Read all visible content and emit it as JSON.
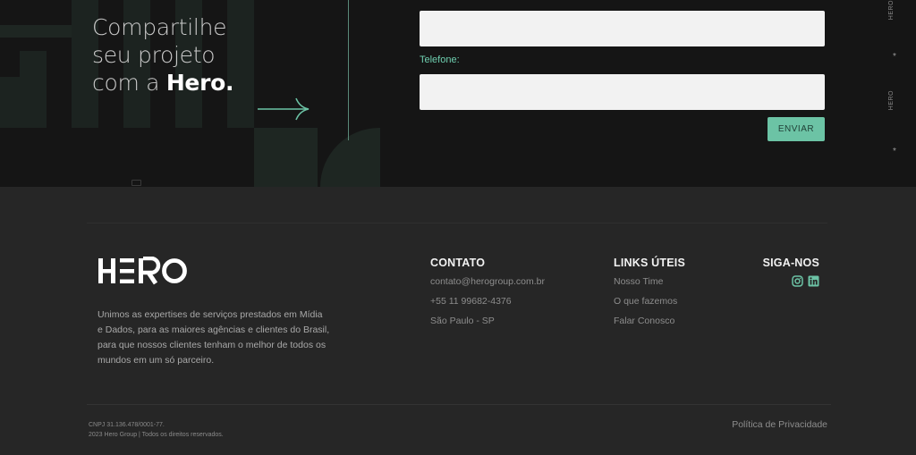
{
  "hero": {
    "heading_line1": "Compartilhe",
    "heading_line2": "seu projeto",
    "heading_line3_prefix": "com a ",
    "heading_brand": "Hero."
  },
  "form": {
    "top_field_value": "",
    "phone_label": "Telefone:",
    "phone_value": "",
    "send_label": "ENVIAR"
  },
  "side_rail": {
    "text_1": "HERO",
    "star_1": "*",
    "text_2": "HERO",
    "star_2": "*"
  },
  "footer": {
    "about": "Unimos as expertises de serviços prestados em Mídia e Dados, para as maiores agências e clientes do Brasil, para que nossos clientes tenham o melhor de todos os mundos em um só parceiro.",
    "contato": {
      "title": "CONTATO",
      "items": [
        "contato@herogroup.com.br",
        "+55 11 99682-4376",
        "São Paulo - SP"
      ]
    },
    "links": {
      "title": "LINKS ÚTEIS",
      "items": [
        "Nosso Time",
        "O que fazemos",
        "Falar Conosco"
      ]
    },
    "siga": {
      "title": "SIGA-NOS",
      "icons": [
        "instagram-icon",
        "linkedin-icon"
      ]
    },
    "legal_line1": "CNPJ 31.136.478/0001-77.",
    "legal_line2": "2023 Hero Group | Todos os direitos reservados.",
    "privacy_label": "Política de Privacidade"
  },
  "colors": {
    "accent": "#6cc3a5",
    "hero_bg": "#151515",
    "footer_bg": "#262626",
    "label_green": "#6fcfb0"
  }
}
